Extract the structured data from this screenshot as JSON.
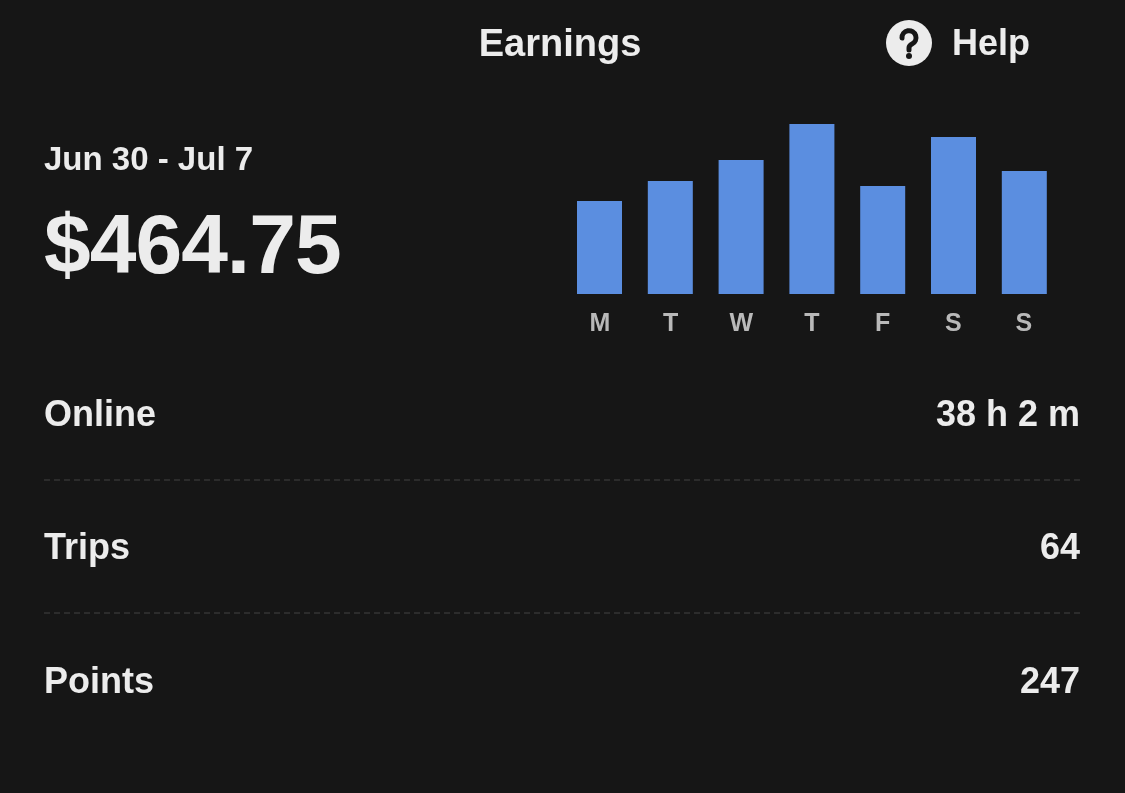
{
  "header": {
    "title": "Earnings",
    "help": "Help"
  },
  "summary": {
    "period": "Jun 30 - Jul 7",
    "total": "$464.75"
  },
  "weekly_chart": {
    "day_labels": [
      "M",
      "T",
      "W",
      "T",
      "F",
      "S",
      "S"
    ]
  },
  "stats": [
    {
      "label": "Online",
      "value": "38 h 2 m"
    },
    {
      "label": "Trips",
      "value": "64"
    },
    {
      "label": "Points",
      "value": "247"
    }
  ]
}
